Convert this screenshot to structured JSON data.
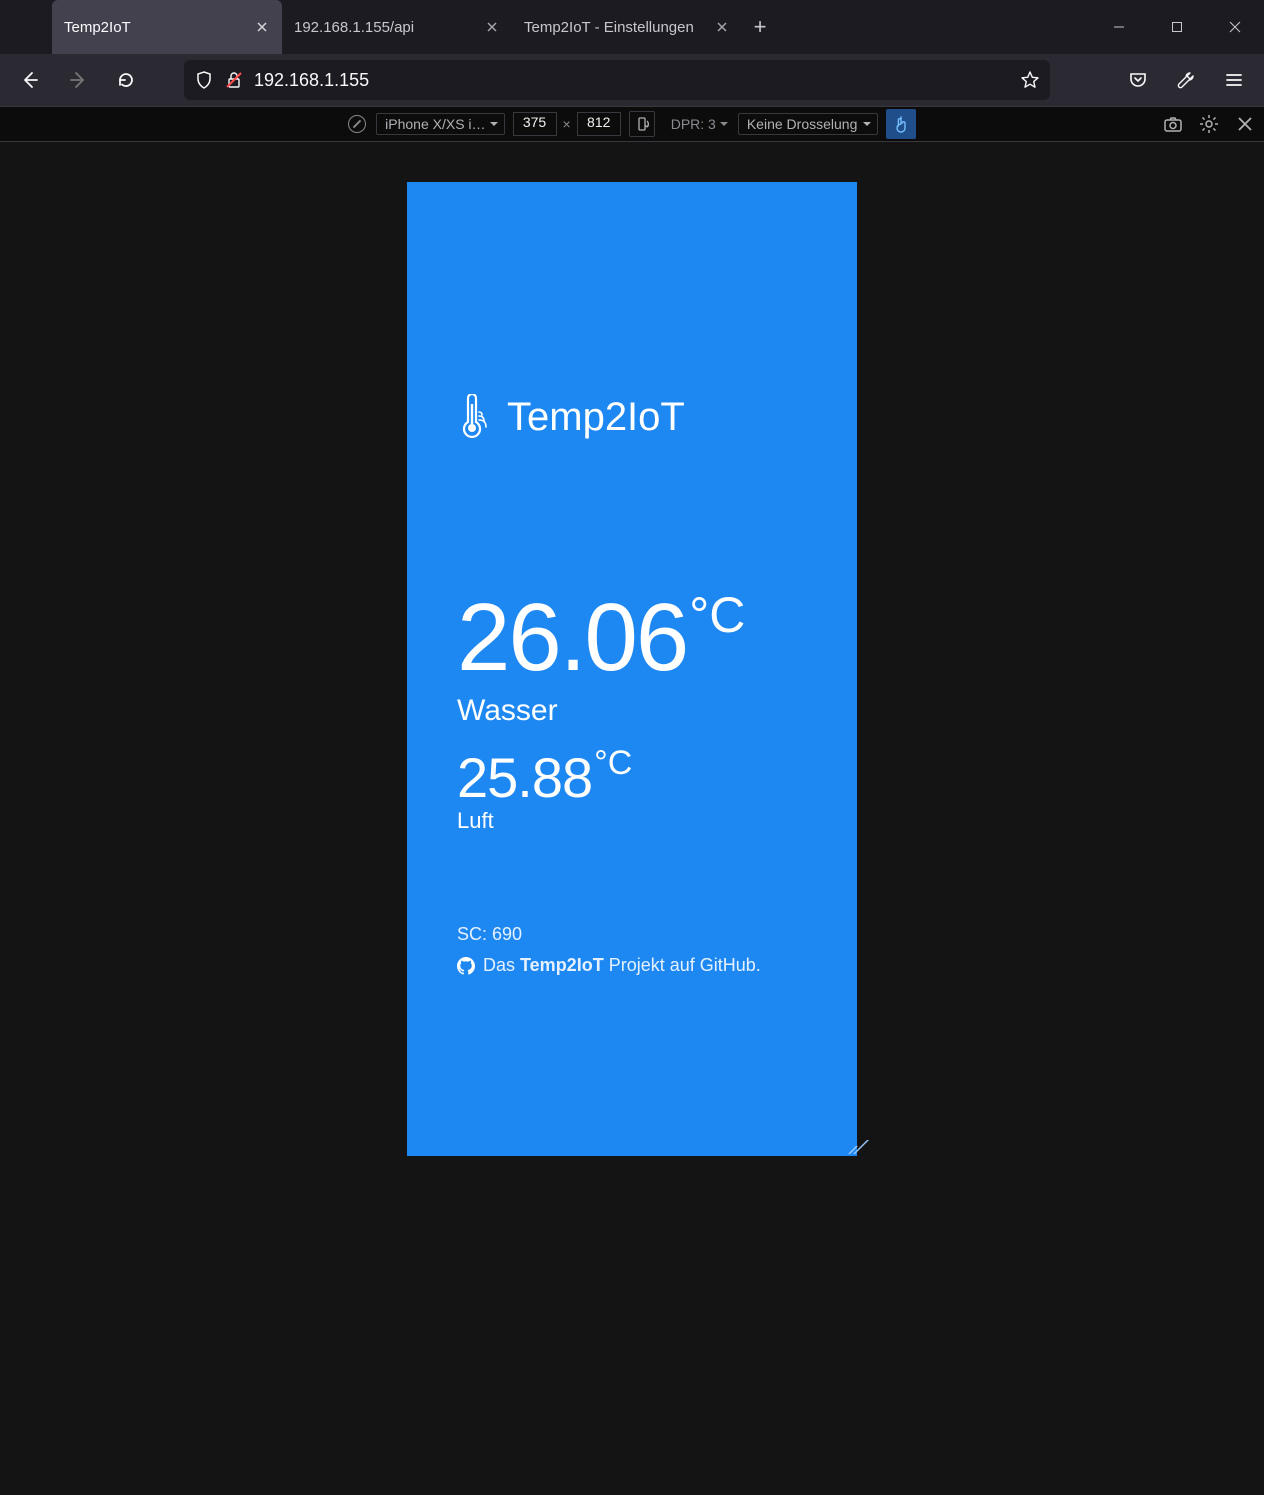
{
  "tabs": [
    {
      "title": "Temp2IoT",
      "active": true
    },
    {
      "title": "192.168.1.155/api",
      "active": false
    },
    {
      "title": "Temp2IoT - Einstellungen",
      "active": false
    }
  ],
  "url": "192.168.1.155",
  "devtools": {
    "device": "iPhone X/XS i…",
    "width": "375",
    "height": "812",
    "dpr": "DPR: 3",
    "throttling": "Keine Drosselung"
  },
  "page": {
    "title": "Temp2IoT",
    "primary": {
      "value": "26.06",
      "unit": "°C",
      "label": "Wasser"
    },
    "secondary": {
      "value": "25.88",
      "unit": "°C",
      "label": "Luft"
    },
    "sc": "SC: 690",
    "github_pre": "Das ",
    "github_name": "Temp2IoT",
    "github_post": " Projekt auf GitHub."
  }
}
